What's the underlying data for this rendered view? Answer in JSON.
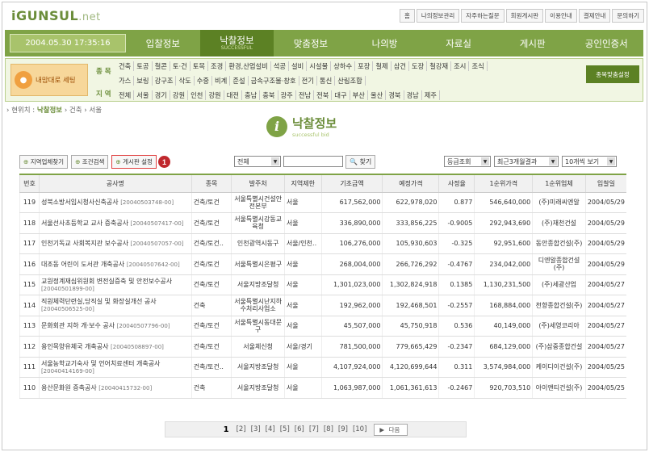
{
  "logo": {
    "main": "iGUNSUL",
    "suffix": ".net"
  },
  "toplinks": [
    "홈",
    "나의정보관리",
    "자주하는질문",
    "회원게시판",
    "이용안내",
    "결제안내",
    "문의하기"
  ],
  "nav": {
    "datetime": "2004.05.30 17:35:16",
    "items": [
      "입찰정보",
      "낙찰정보",
      "맞춤정보",
      "나의방",
      "자료실",
      "게시판",
      "공인인증서"
    ],
    "active_sub": "SUCCESSFUL"
  },
  "fit_button": "내맘대로 세팅",
  "categories": {
    "jong_label": "종 목",
    "region_label": "지 역",
    "row1": [
      "건축",
      "토공",
      "철콘",
      "토·건",
      "토목",
      "조경",
      "환경,산업설비",
      "석공",
      "설비",
      "시설물",
      "상하수",
      "포장",
      "철제",
      "삼건",
      "도장",
      "철강재",
      "조시",
      "조식"
    ],
    "row2": [
      "가스",
      "보링",
      "강구조",
      "삭도",
      "수중",
      "비계",
      "준설",
      "금속구조물·창호",
      "전기",
      "통신",
      "산림조합"
    ],
    "region": [
      "전체",
      "서울",
      "경기",
      "강원",
      "인천",
      "강원",
      "대전",
      "충남",
      "충북",
      "광주",
      "전남",
      "전북",
      "대구",
      "부산",
      "울산",
      "경북",
      "경남",
      "제주"
    ]
  },
  "custom_button": "종목맞춤설정",
  "breadcrumb": {
    "prefix": "› 현위치 :",
    "current": "낙찰정보",
    "rest": "› 건축 › 서울"
  },
  "page_title": {
    "main": "낙찰정보",
    "sub": "successful bid"
  },
  "toolbar": {
    "btn1": "지역업체찾기",
    "btn2": "조건검색",
    "btn3": "게시판 설정",
    "badge": "1",
    "filter": "전체",
    "search": "찾기",
    "sel1": "등급조회",
    "sel2": "최근3개월결과",
    "sel3": "10개씩 보기"
  },
  "table": {
    "headers": [
      "번호",
      "공사명",
      "종목",
      "발주처",
      "지역제한",
      "기초금액",
      "예정가격",
      "사정율",
      "1순위가격",
      "1순위업체",
      "입찰일"
    ],
    "rows": [
      {
        "no": "119",
        "name": "성북소방서임시청사신축공사",
        "code": "[20040503748-00]",
        "kind": "건축/토건",
        "org": "서울특별시건설안전본부",
        "region": "서울",
        "base": "617,562,000",
        "est": "622,978,020",
        "rate": "0.877",
        "price": "546,640,000",
        "winner": "(주)미래씨엔알",
        "date": "2004/05/29"
      },
      {
        "no": "118",
        "name": "서울선사초등학교 교사 증축공사",
        "code": "[20040507417-00]",
        "kind": "건축/토건",
        "org": "서울특별시강동교육청",
        "region": "서울",
        "base": "336,890,000",
        "est": "333,856,225",
        "rate": "-0.9005",
        "price": "292,943,690",
        "winner": "(주)재천건설",
        "date": "2004/05/29"
      },
      {
        "no": "117",
        "name": "인천기독교 사회복지관 보수공사",
        "code": "[20040507057-00]",
        "kind": "건축/토건..",
        "org": "인천광역시동구",
        "region": "서울/인천..",
        "base": "106,276,000",
        "est": "105,930,603",
        "rate": "-0.325",
        "price": "92,951,600",
        "winner": "동안종합건설(주)",
        "date": "2004/05/29"
      },
      {
        "no": "116",
        "name": "대조동 어린이 도서관 개축공사",
        "code": "[20040507642-00]",
        "kind": "건축/토건",
        "org": "서울특별시은평구",
        "region": "서울",
        "base": "268,004,000",
        "est": "266,726,292",
        "rate": "-0.4767",
        "price": "234,042,000",
        "winner": "디엔알종합건설(주)",
        "date": "2004/05/29"
      },
      {
        "no": "115",
        "name": "교원정계재심위원회 변전실증축 및 안전보수공사",
        "code": "[20040501899-00]",
        "kind": "건축/토건",
        "org": "서울지방조달청",
        "region": "서울",
        "base": "1,301,023,000",
        "est": "1,302,824,918",
        "rate": "0.1385",
        "price": "1,130,231,500",
        "winner": "(주)세광산업",
        "date": "2004/05/27"
      },
      {
        "no": "114",
        "name": "직원체력단련실,당직실 및 화장실개선 공사",
        "code": "[20040506525-00]",
        "kind": "건축",
        "org": "서울특별시난지하수처리사업소",
        "region": "서울",
        "base": "192,962,000",
        "est": "192,468,501",
        "rate": "-0.2557",
        "price": "168,884,000",
        "winner": "천향종합건설(주)",
        "date": "2004/05/27"
      },
      {
        "no": "113",
        "name": "문화회관 지하 개·보수 공사",
        "code": "[20040507796-00]",
        "kind": "건축/토건",
        "org": "서울특별시동대문구",
        "region": "서울",
        "base": "45,507,000",
        "est": "45,750,918",
        "rate": "0.536",
        "price": "40,149,000",
        "winner": "(주)세영코리아",
        "date": "2004/05/27"
      },
      {
        "no": "112",
        "name": "용인목양유체국 개축공사",
        "code": "[20040508897-00]",
        "kind": "건축/토건",
        "org": "서울체신청",
        "region": "서울/경기",
        "base": "781,500,000",
        "est": "779,665,429",
        "rate": "-0.2347",
        "price": "684,129,000",
        "winner": "(주)삼중종합건설",
        "date": "2004/05/27"
      },
      {
        "no": "111",
        "name": "서울농학교기숙사 및 언어치료센터 개축공사",
        "code": "[20040414169-00]",
        "kind": "건축/토건..",
        "org": "서울지방조달청",
        "region": "서울",
        "base": "4,107,924,000",
        "est": "4,120,699,644",
        "rate": "0.311",
        "price": "3,574,984,000",
        "winner": "케이디이건설(주)",
        "date": "2004/05/25"
      },
      {
        "no": "110",
        "name": "용산문화원 증축공사",
        "code": "[20040415732-00]",
        "kind": "건축",
        "org": "서울지방조달청",
        "region": "서울",
        "base": "1,063,987,000",
        "est": "1,061,361,613",
        "rate": "-0.2467",
        "price": "920,703,510",
        "winner": "아이앤티건설(주)",
        "date": "2004/05/25"
      }
    ]
  },
  "pager": {
    "current": "1",
    "pages": [
      "[2]",
      "[3]",
      "[4]",
      "[5]",
      "[6]",
      "[7]",
      "[8]",
      "[9]",
      "[10]"
    ],
    "next": "다음"
  }
}
